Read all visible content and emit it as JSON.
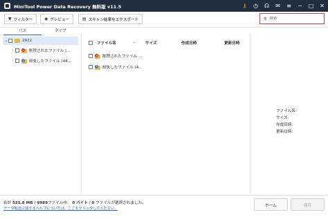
{
  "window": {
    "title": "MiniTool Power Data Recovery 無料版 v11.5"
  },
  "toolbar": {
    "filter_label": "フィルター",
    "preview_label": "プレビュー",
    "export_label": "スキャン結果をエクスポート",
    "search_placeholder": "検索"
  },
  "left_panel": {
    "tabs": [
      {
        "label": "パス",
        "active": true
      },
      {
        "label": "タイプ",
        "active": false
      }
    ],
    "tree": [
      {
        "label": "2022",
        "selected": true
      },
      {
        "label": "削除されたファイル (..."
      },
      {
        "label": "紛失したファイル (44..."
      }
    ]
  },
  "file_list": {
    "columns": [
      "ファイル名",
      "サイズ",
      "作成日時",
      "更新日時"
    ],
    "rows": [
      {
        "name": "削除されたファイル ...",
        "size": "",
        "created": "",
        "modified": ""
      },
      {
        "name": "紛失したファイル (4...",
        "size": "",
        "created": "",
        "modified": ""
      }
    ]
  },
  "preview_panel": {
    "labels": [
      "ファイル名:",
      "サイズ:",
      "作成日時:",
      "更新日時:"
    ]
  },
  "status": {
    "total_prefix": "合計",
    "total_size": "525.8 MB / 9989",
    "total_suffix": "ファイル中、",
    "selected_size": "0 バイト",
    "selected_sep": " / ",
    "selected_count": "0",
    "selected_suffix": " ファイルが選択されました。",
    "help_link": "データ転送に関するヘルプについては、ここをクリックしてください。"
  },
  "buttons": {
    "home": "ホーム",
    "save": "保存"
  },
  "colors": {
    "titlebar": "#1f2f3f",
    "accent": "#2a66c8",
    "search_border": "#d43a3a"
  }
}
